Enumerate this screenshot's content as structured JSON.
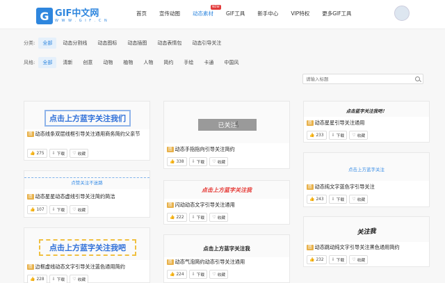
{
  "header": {
    "logo_mark": "G",
    "logo_text": "GIF中文网",
    "logo_sub": "W W W . G I F . C N",
    "nav": [
      "首页",
      "宣传动图",
      "动态素材",
      "GIF工具",
      "新手中心",
      "VIP特权",
      "更多GIF工具"
    ],
    "new_badge": "NEW"
  },
  "filters": {
    "category_label": "分类:",
    "categories": [
      "全部",
      "动态分割线",
      "动态图标",
      "动态插图",
      "动态表情包",
      "动态引导关注"
    ],
    "style_label": "风格:",
    "styles": [
      "全部",
      "清新",
      "创意",
      "动物",
      "植物",
      "人物",
      "简约",
      "手绘",
      "卡通",
      "中国风"
    ]
  },
  "search": {
    "placeholder": "请输入标题"
  },
  "tag": "图",
  "buttons": {
    "download": "下载",
    "favorite": "收藏"
  },
  "cards": [
    {
      "thumb": "点击上方蓝字关注我们",
      "title": "动态线条双层线框引导关注通用商务简约父亲节",
      "likes": "275"
    },
    {
      "thumb": "点赞关注不迷路",
      "title": "动态星星动态虚线引导关注简约简洁",
      "likes": "107"
    },
    {
      "thumb": "点击上方蓝字关注我吧",
      "title": "边框虚线动态文字引导关注蓝色通用简约",
      "likes": "228"
    },
    {
      "thumb": "已关注",
      "title": "动态手指指向引导关注简约",
      "likes": "338"
    },
    {
      "thumb": "点击上方蓝字关注我",
      "title": "闪动动态文字引导关注通用",
      "likes": "222"
    },
    {
      "thumb": "点击上方蓝字关注我",
      "title": "动态气泡简约动态引导关注通用",
      "likes": "224"
    },
    {
      "thumb": "点击蓝字关注我吧！",
      "title": "动态星星引导关注通用",
      "likes": "233"
    },
    {
      "thumb": "点击上方蓝字关注",
      "title": "动态纯文字蓝色字引导关注",
      "likes": "243"
    },
    {
      "thumb": "关注我",
      "title": "动态跳动纯文字引导关注黑色通用简约",
      "likes": "232"
    }
  ],
  "colors": {
    "accent": "#2e86de",
    "badge": "#e23a3a",
    "tag": "#e8b14a"
  }
}
